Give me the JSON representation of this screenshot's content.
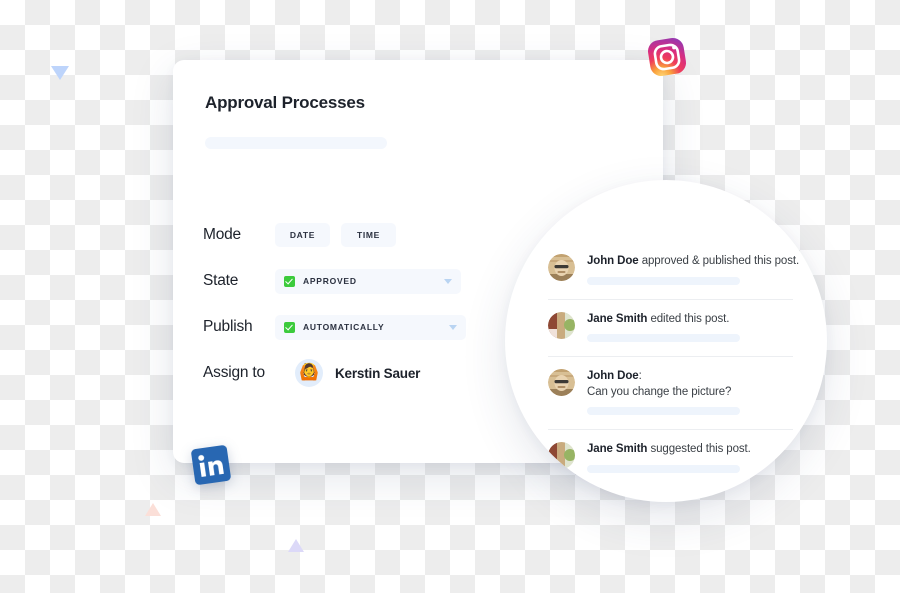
{
  "card": {
    "title": "Approval Processes",
    "rows": {
      "mode": {
        "label": "Mode",
        "options": [
          "DATE",
          "TIME"
        ]
      },
      "state": {
        "label": "State",
        "value": "APPROVED",
        "checked": true
      },
      "publish": {
        "label": "Publish",
        "value": "AUTOMATICALLY",
        "checked": true
      },
      "assign": {
        "label": "Assign to",
        "assignee": "Kerstin Sauer",
        "avatar_glyph": "🙆"
      }
    }
  },
  "activity": {
    "items": [
      {
        "author": "John Doe",
        "action": " approved & published this post.",
        "second_line": "",
        "avatar": "john-doe-avatar"
      },
      {
        "author": "Jane Smith",
        "action": " edited this post.",
        "second_line": "",
        "avatar": "jane-smith-avatar"
      },
      {
        "author": "John Doe",
        "action": ":",
        "second_line": "Can you change the picture?",
        "avatar": "john-doe-avatar"
      },
      {
        "author": "Jane Smith",
        "action": " suggested this post.",
        "second_line": "",
        "avatar": "jane-smith-avatar"
      }
    ]
  },
  "brand_icons": {
    "instagram": "instagram-icon",
    "linkedin": "linkedin-icon"
  },
  "colors": {
    "accent_green": "#3ccb3c",
    "field_bg": "#f5f8fd",
    "skeleton": "#eef4fc",
    "text_primary": "#1d222b",
    "linkedin_blue": "#2867b2"
  }
}
